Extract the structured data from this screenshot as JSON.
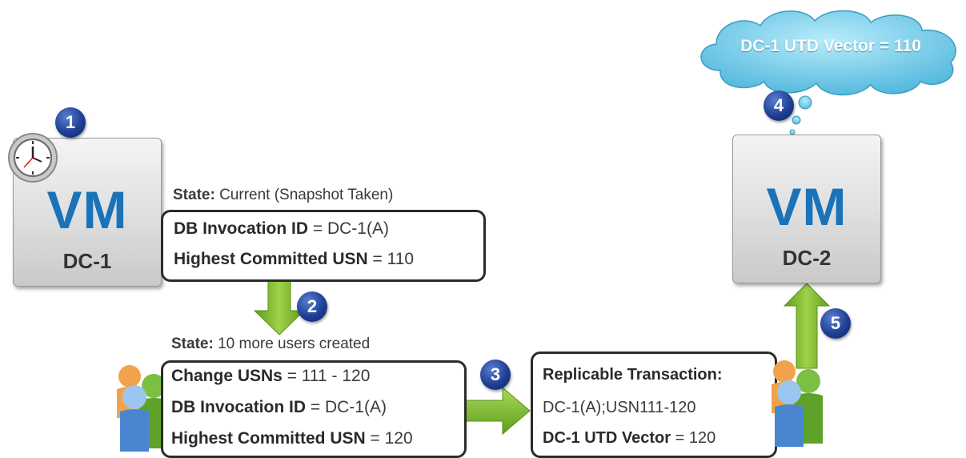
{
  "vm_left": {
    "logo": "VM",
    "name": "DC-1"
  },
  "vm_right": {
    "logo": "VM",
    "name": "DC-2"
  },
  "badges": {
    "b1": "1",
    "b2": "2",
    "b3": "3",
    "b4": "4",
    "b5": "5"
  },
  "state_top": {
    "label": "State:",
    "text": " Current  (Snapshot Taken)"
  },
  "box_top": {
    "row1_label": "DB Invocation ID",
    "row1_value": " = DC-1(A)",
    "row2_label": "Highest Committed USN",
    "row2_value": " = 110"
  },
  "state_mid": {
    "label": "State:",
    "text": " 10 more users created"
  },
  "box_mid": {
    "row1_label": "Change USNs",
    "row1_value": " = 111 - 120",
    "row2_label": "DB Invocation ID",
    "row2_value": " = DC-1(A)",
    "row3_label": "Highest Committed USN",
    "row3_value": " = 120"
  },
  "box_repl": {
    "title": "Replicable Transaction:",
    "row2": "DC-1(A);USN111-120",
    "row3_label": "DC-1",
    "row3_middle": " UTD Vector",
    "row3_value": " = 120"
  },
  "cloud": {
    "text": "DC-1 UTD Vector = 110"
  },
  "colors": {
    "vm_text": "#1a73b8",
    "arrow_green": "#7dbb2e",
    "badge_blue": "#1f3f95",
    "cloud_blue": "#6fc6e6"
  },
  "icons": [
    "clock-icon",
    "users-icon",
    "users-icon",
    "arrow-down",
    "arrow-right",
    "arrow-up",
    "thought-cloud"
  ]
}
